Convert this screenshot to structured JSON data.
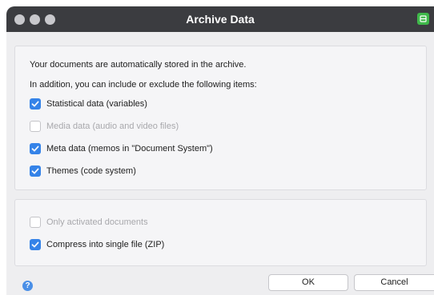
{
  "window": {
    "title": "Archive Data"
  },
  "intro": {
    "line1": "Your documents are automatically stored in the archive.",
    "line2": "In addition, you can include or exclude the following items:"
  },
  "items": [
    {
      "label": "Statistical data (variables)",
      "checked": true,
      "enabled": true
    },
    {
      "label": "Media data (audio and video files)",
      "checked": false,
      "enabled": false
    },
    {
      "label": "Meta data (memos in \"Document System\")",
      "checked": true,
      "enabled": true
    },
    {
      "label": "Themes (code system)",
      "checked": true,
      "enabled": true
    }
  ],
  "options": [
    {
      "label": "Only activated documents",
      "checked": false,
      "enabled": false
    },
    {
      "label": "Compress into single file (ZIP)",
      "checked": true,
      "enabled": true
    }
  ],
  "footer": {
    "help_glyph": "?",
    "ok_label": "OK",
    "cancel_label": "Cancel"
  },
  "colors": {
    "accent": "#3583e8",
    "titlebar": "#3b3c40",
    "app_badge": "#3fb84a"
  }
}
